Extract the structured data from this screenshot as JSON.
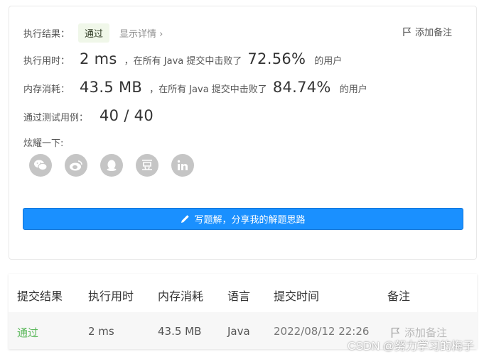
{
  "result": {
    "label": "执行结果：",
    "status": "通过",
    "details": "显示详情 ›",
    "add_note": "添加备注"
  },
  "runtime": {
    "label": "执行用时：",
    "value": "2 ms",
    "beat_prefix": "，在所有 Java 提交中击败了",
    "percent": "72.56%",
    "suffix": "的用户"
  },
  "memory": {
    "label": "内存消耗：",
    "value": "43.5 MB",
    "beat_prefix": "，在所有 Java 提交中击败了",
    "percent": "84.74%",
    "suffix": "的用户"
  },
  "tests": {
    "label": "通过测试用例：",
    "value": "40 / 40"
  },
  "share": {
    "label": "炫耀一下:",
    "icons": [
      "wechat-icon",
      "weibo-icon",
      "qq-icon",
      "douban-icon",
      "linkedin-icon"
    ]
  },
  "cta": {
    "label": "写题解，分享我的解题思路"
  },
  "table": {
    "headers": [
      "提交结果",
      "执行用时",
      "内存消耗",
      "语言",
      "提交时间",
      "备注"
    ],
    "row": {
      "result": "通过",
      "runtime": "2 ms",
      "memory": "43.5 MB",
      "language": "Java",
      "time": "2022/08/12 22:26",
      "note": "添加备注"
    }
  },
  "watermark": "CSDN @努力学习的梅子",
  "colors": {
    "accent": "#1a90ff",
    "pass": "#5cb85c",
    "badge_bg": "#f0f7e9",
    "icon_gray": "#c5c5c5"
  }
}
